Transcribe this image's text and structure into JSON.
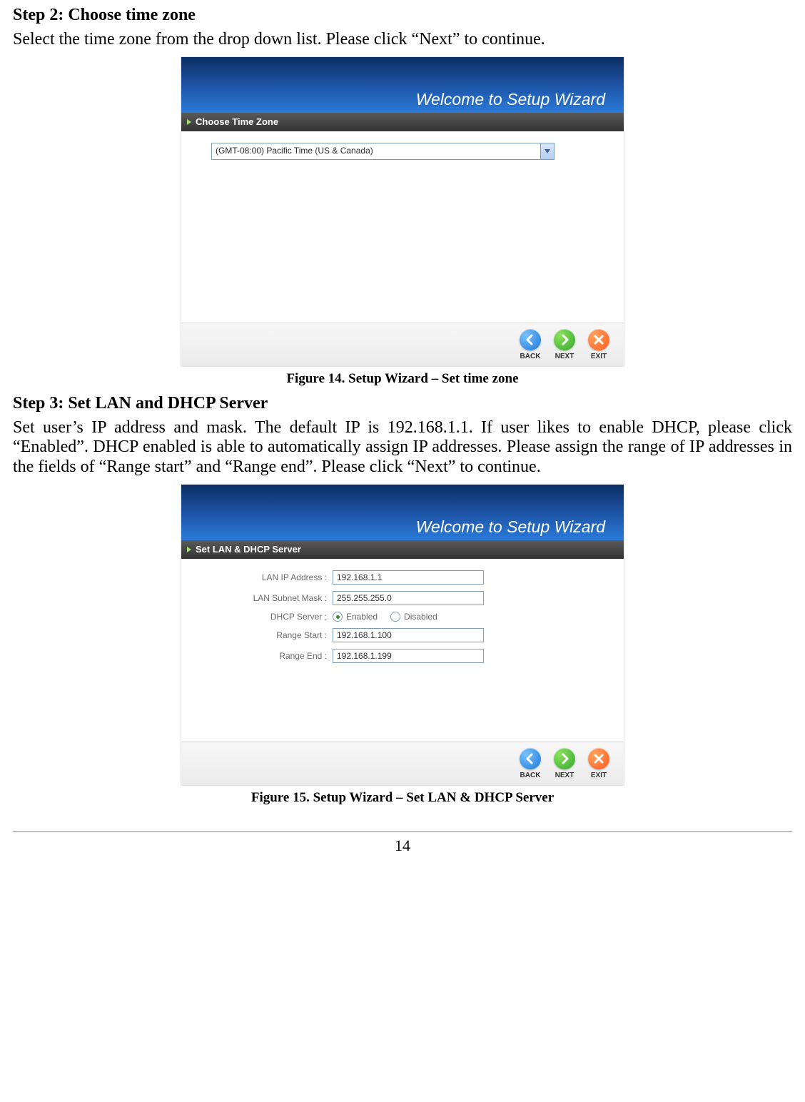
{
  "step2": {
    "heading": "Step 2: Choose time zone",
    "desc": "Select the time zone from the drop down list. Please click “Next” to continue.",
    "caption": "Figure 14. Setup Wizard – Set time zone"
  },
  "step3": {
    "heading": "Step 3: Set LAN and DHCP Server",
    "desc": "Set user’s IP address and mask. The default IP is 192.168.1.1. If user likes to enable DHCP, please click “Enabled”. DHCP enabled is able to automatically assign IP addresses. Please assign the range of IP addresses in the fields of “Range start” and “Range end”. Please click “Next” to continue.",
    "caption": "Figure 15. Setup Wizard – Set LAN & DHCP Server"
  },
  "wiz": {
    "banner": "Welcome to Setup Wizard",
    "tz_section": "Choose Time Zone",
    "tz_value": "(GMT-08:00) Pacific Time (US & Canada)",
    "lan_section": "Set LAN & DHCP Server",
    "labels": {
      "lan_ip": "LAN IP Address :",
      "lan_mask": "LAN Subnet Mask :",
      "dhcp": "DHCP Server :",
      "rstart": "Range Start :",
      "rend": "Range End :"
    },
    "values": {
      "lan_ip": "192.168.1.1",
      "lan_mask": "255.255.255.0",
      "rstart": "192.168.1.100",
      "rend": "192.168.1.199"
    },
    "radio": {
      "enabled": "Enabled",
      "disabled": "Disabled"
    },
    "buttons": {
      "back": "BACK",
      "next": "NEXT",
      "exit": "EXIT"
    }
  },
  "page_number": "14"
}
